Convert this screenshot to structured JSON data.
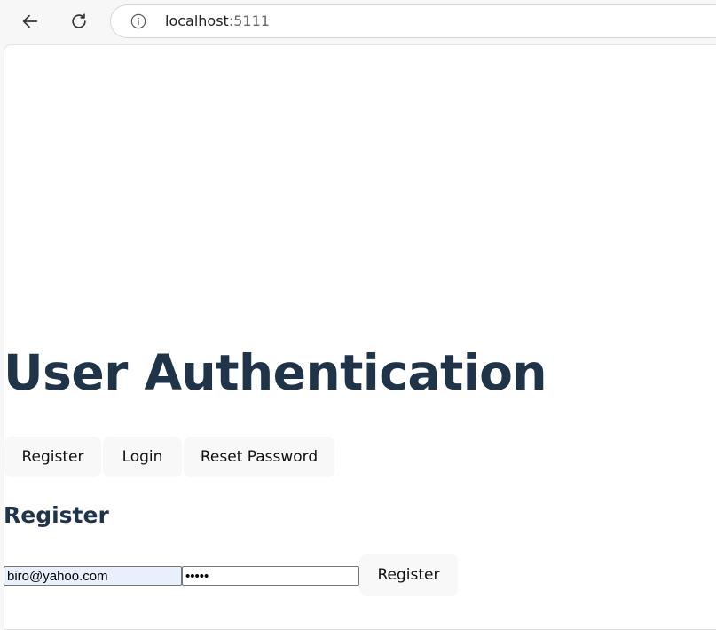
{
  "browser": {
    "url_host": "localhost",
    "url_port": ":5111",
    "icons": {
      "back": "back-arrow-icon",
      "reload": "reload-icon",
      "info": "info-icon"
    }
  },
  "page": {
    "title": "User Authentication",
    "mode_buttons": [
      "Register",
      "Login",
      "Reset Password"
    ],
    "section_title": "Register",
    "form": {
      "email_value": "biro@yahoo.com",
      "password_value": "12345",
      "submit_label": "Register"
    }
  },
  "colors": {
    "heading": "#1f3349",
    "autofill_bg": "#e8f0fe",
    "button_bg": "#f8f8f8"
  }
}
